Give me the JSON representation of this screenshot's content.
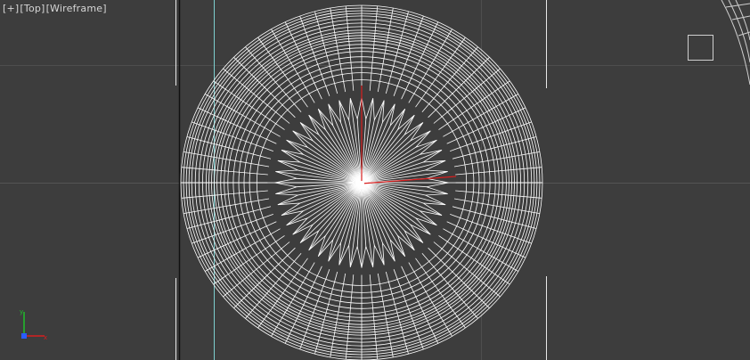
{
  "viewport": {
    "labels": {
      "plus": "[+]",
      "view": "[Top]",
      "shading": "[Wireframe]"
    }
  },
  "colors": {
    "background": "#3d3d3d",
    "grid_line": "#4d4d4d",
    "wireframe": "#ffffff",
    "axis_x": "#d81e1e",
    "axis_y": "#1fbf2a",
    "axis_z": "#2a5cff",
    "guide_cyan": "#7ecfcf"
  },
  "icons": {
    "viewcube": "viewcube-square-icon",
    "axis_tripod": "axis-tripod-icon",
    "pivot": "transform-gizmo-icon"
  }
}
